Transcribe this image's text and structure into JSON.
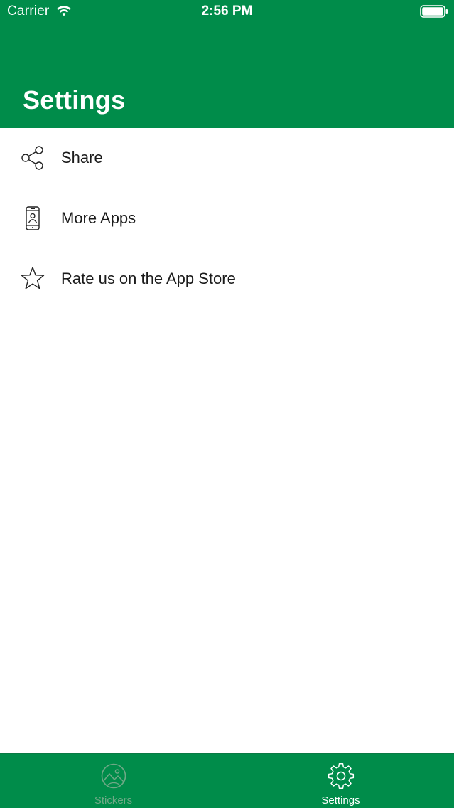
{
  "status_bar": {
    "carrier": "Carrier",
    "time": "2:56 PM",
    "wifi_icon": "wifi-icon",
    "battery_icon": "battery-icon"
  },
  "header": {
    "title": "Settings",
    "background_color": "#008C4A"
  },
  "settings_list": [
    {
      "label": "Share",
      "icon": "share-icon"
    },
    {
      "label": "More Apps",
      "icon": "phone-contact-icon"
    },
    {
      "label": "Rate us on the App Store",
      "icon": "star-icon"
    }
  ],
  "tab_bar": {
    "tabs": [
      {
        "label": "Stickers",
        "icon": "image-icon",
        "selected": false
      },
      {
        "label": "Settings",
        "icon": "gear-icon",
        "selected": true
      }
    ],
    "selected_color": "#ffffff",
    "unselected_color": "#6fa886"
  }
}
